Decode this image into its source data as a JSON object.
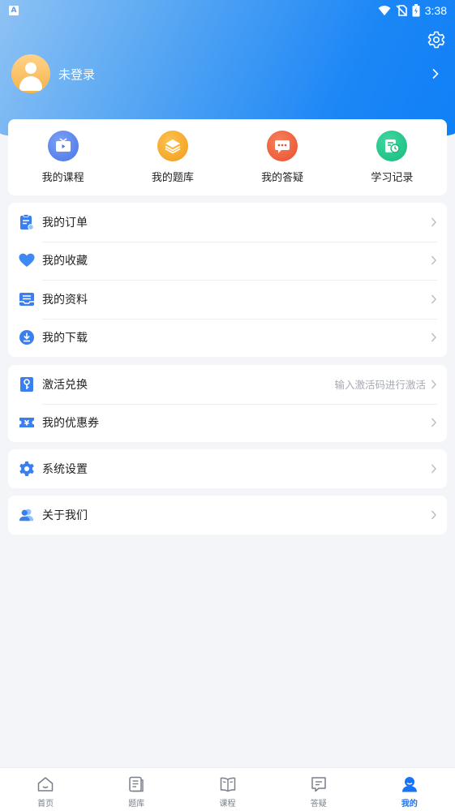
{
  "status_bar": {
    "notification_icon": "A",
    "time": "3:38"
  },
  "profile": {
    "username": "未登录"
  },
  "quick_links": [
    {
      "label": "我的课程",
      "icon": "tv-icon",
      "color": "#5b86ef"
    },
    {
      "label": "我的题库",
      "icon": "layers-icon",
      "color": "#f5a623"
    },
    {
      "label": "我的答疑",
      "icon": "chat-icon",
      "color": "#f0643f"
    },
    {
      "label": "学习记录",
      "icon": "record-icon",
      "color": "#24c48b"
    }
  ],
  "menu_group_1": [
    {
      "label": "我的订单",
      "icon": "order-icon"
    },
    {
      "label": "我的收藏",
      "icon": "heart-icon"
    },
    {
      "label": "我的资料",
      "icon": "inbox-icon"
    },
    {
      "label": "我的下载",
      "icon": "download-icon"
    }
  ],
  "menu_group_2": [
    {
      "label": "激活兑换",
      "hint": "输入激活码进行激活",
      "icon": "key-icon"
    },
    {
      "label": "我的优惠券",
      "icon": "coupon-icon"
    }
  ],
  "menu_group_3": [
    {
      "label": "系统设置",
      "icon": "settings-icon"
    }
  ],
  "menu_group_4": [
    {
      "label": "关于我们",
      "icon": "users-icon"
    }
  ],
  "tab_bar": [
    {
      "label": "首页",
      "icon": "home-icon"
    },
    {
      "label": "题库",
      "icon": "question-bank-icon"
    },
    {
      "label": "课程",
      "icon": "book-icon"
    },
    {
      "label": "答疑",
      "icon": "qa-icon"
    },
    {
      "label": "我的",
      "icon": "profile-icon",
      "active": true
    }
  ],
  "colors": {
    "accent": "#1a73f5",
    "header_start": "#8ec2f4",
    "header_end": "#0f80f7"
  }
}
